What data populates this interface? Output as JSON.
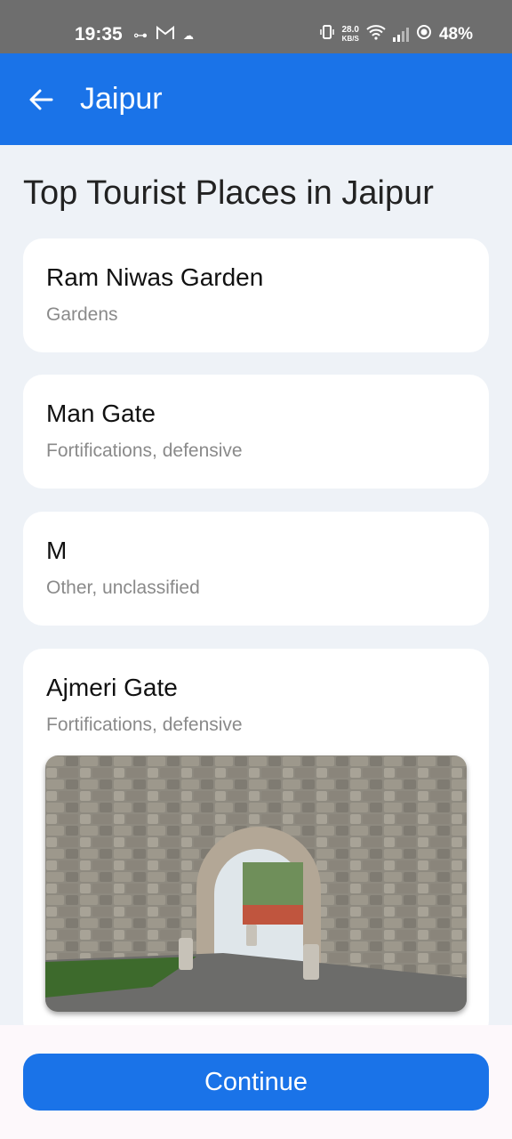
{
  "status_bar": {
    "time": "19:35",
    "net_speed_value": "28.0",
    "net_speed_unit": "KB/S",
    "battery": "48%"
  },
  "app_bar": {
    "title": "Jaipur"
  },
  "page": {
    "heading": "Top Tourist Places in Jaipur"
  },
  "places": [
    {
      "name": "Ram Niwas Garden",
      "category": "Gardens"
    },
    {
      "name": "Man Gate",
      "category": "Fortifications, defensive"
    },
    {
      "name": "M",
      "category": "Other, unclassified"
    },
    {
      "name": "Ajmeri Gate",
      "category": "Fortifications, defensive"
    }
  ],
  "continue_label": "Continue",
  "colors": {
    "app_bar": "#1a73e8",
    "background": "#eef2f7",
    "status_bar": "#6e6e6e"
  }
}
